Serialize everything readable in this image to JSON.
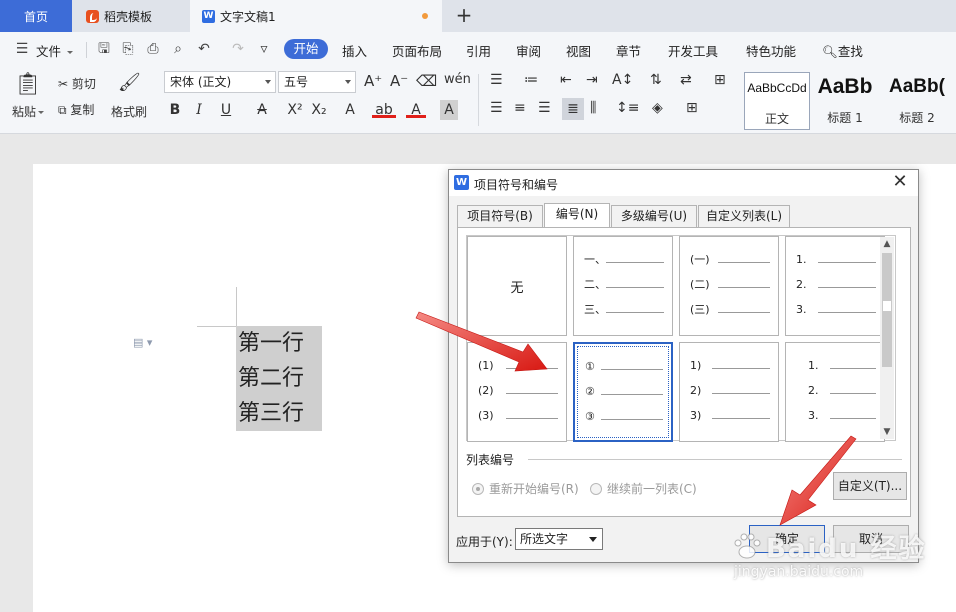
{
  "tabs": {
    "home": "首页",
    "daoke": "稻壳模板",
    "doc": "文字文稿1",
    "new_tab": "+"
  },
  "menu": {
    "file": "文件",
    "start": "开始",
    "insert": "插入",
    "layout": "页面布局",
    "references": "引用",
    "review": "审阅",
    "view": "视图",
    "section": "章节",
    "developer": "开发工具",
    "special": "特色功能",
    "search": "查找"
  },
  "ribbon": {
    "paste": "粘贴",
    "cut": "剪切",
    "copy": "复制",
    "format_painter": "格式刷",
    "font_name": "宋体 (正文)",
    "font_size": "五号",
    "styles": [
      {
        "sample": "AaBbCcDd",
        "name": "正文"
      },
      {
        "sample": "AaBb",
        "name": "标题 1"
      },
      {
        "sample": "AaBb(",
        "name": "标题 2"
      }
    ]
  },
  "document": {
    "lines": [
      "第一行",
      "第二行",
      "第三行"
    ]
  },
  "dialog": {
    "title": "项目符号和编号",
    "tabs": [
      "项目符号(B)",
      "编号(N)",
      "多级编号(U)",
      "自定义列表(L)"
    ],
    "active_tab": 1,
    "none_label": "无",
    "grid": [
      {
        "type": "none"
      },
      {
        "marks": [
          "一、",
          "二、",
          "三、"
        ]
      },
      {
        "marks": [
          "(一)",
          "(二)",
          "(三)"
        ]
      },
      {
        "marks": [
          "1.",
          "2.",
          "3."
        ]
      },
      {
        "marks": [
          "(1)",
          "(2)",
          "(3)"
        ]
      },
      {
        "marks": [
          "①",
          "②",
          "③"
        ],
        "selected": true
      },
      {
        "marks": [
          "1)",
          "2)",
          "3)"
        ]
      },
      {
        "marks": [
          "1.",
          "2.",
          "3."
        ],
        "indented": true
      }
    ],
    "list_numbering_label": "列表编号",
    "restart_label": "重新开始编号(R)",
    "continue_label": "继续前一列表(C)",
    "customize_label": "自定义(T)...",
    "apply_to_label": "应用于(Y):",
    "apply_to_value": "所选文字",
    "ok_label": "确定",
    "cancel_label": "取消"
  },
  "watermark": {
    "big": "Baidu 经验",
    "small": "jingyan.baidu.com"
  },
  "colors": {
    "accent": "#3d6cd7",
    "arrow": "#e0201a",
    "selection": "#cfcfcf"
  }
}
